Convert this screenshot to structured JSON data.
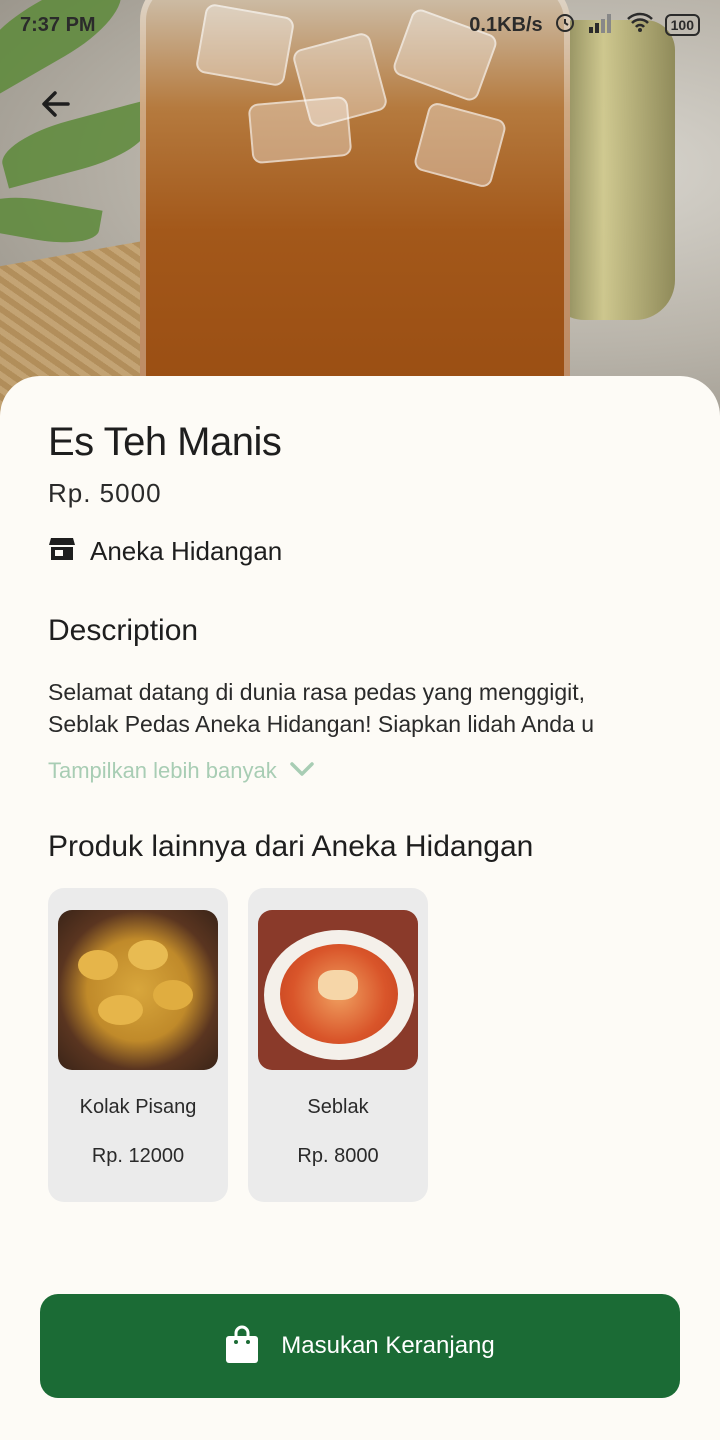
{
  "status_bar": {
    "time": "7:37 PM",
    "network_speed": "0.1KB/s",
    "battery": "100"
  },
  "product": {
    "name": "Es Teh Manis",
    "price": "Rp. 5000",
    "store": "Aneka Hidangan"
  },
  "description": {
    "heading": "Description",
    "line1": "Selamat datang di dunia rasa pedas yang menggigit,",
    "line2": "Seblak Pedas Aneka Hidangan! Siapkan lidah Anda u",
    "show_more": "Tampilkan lebih banyak"
  },
  "related": {
    "heading": "Produk lainnya dari Aneka Hidangan",
    "items": [
      {
        "name": "Kolak Pisang",
        "price": "Rp. 12000"
      },
      {
        "name": "Seblak",
        "price": "Rp. 8000"
      }
    ]
  },
  "cta": {
    "label": "Masukan Keranjang"
  },
  "colors": {
    "primary": "#1b6b35",
    "accent_light": "#a8cdb4",
    "card_bg": "#ebebeb",
    "background": "#fdfbf6"
  },
  "icons": [
    "back-arrow-icon",
    "store-icon",
    "chevron-down-icon",
    "shopping-bag-icon",
    "alarm-icon",
    "signal-icon",
    "wifi-icon",
    "battery-icon"
  ]
}
